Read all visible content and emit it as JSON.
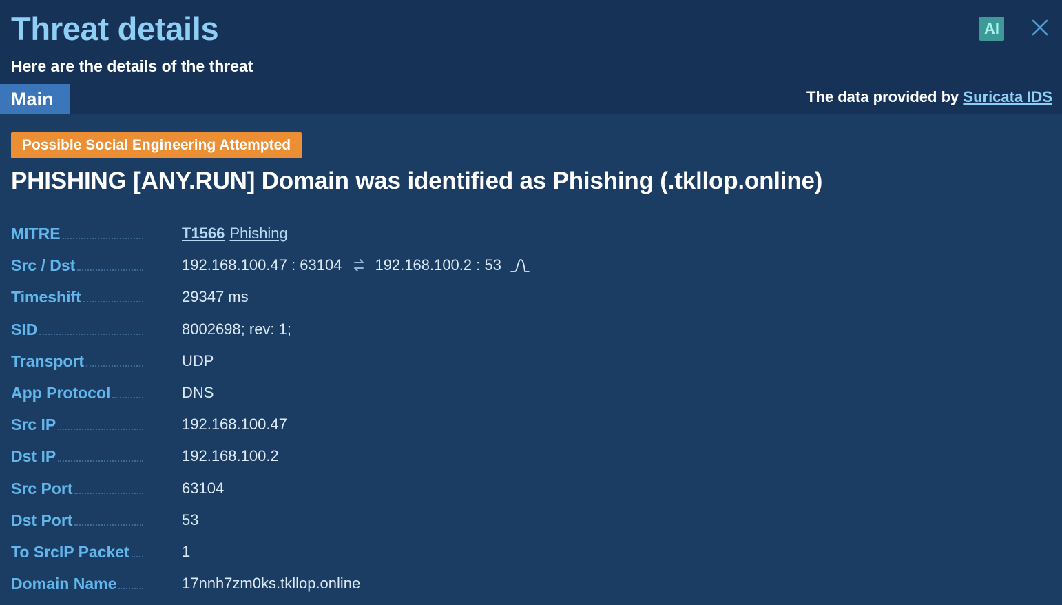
{
  "header": {
    "title": "Threat details",
    "subtitle": "Here are the details of the threat",
    "ai_label": "AI",
    "close_icon": "close-icon",
    "tabs": [
      {
        "label": "Main",
        "active": true
      }
    ],
    "provided_prefix": "The data provided by",
    "provided_link": "Suricata IDS"
  },
  "alert": {
    "category": "Possible Social Engineering Attempted",
    "category_color": "#ec8e34",
    "signature": "PHISHING [ANY.RUN] Domain was identified as Phishing (.tkllop.online)"
  },
  "details": {
    "mitre": {
      "label": "MITRE",
      "technique_id": "T1566",
      "technique_name": "Phishing"
    },
    "src_dst": {
      "label": "Src / Dst",
      "src": "192.168.100.47 : 63104",
      "dst": "192.168.100.2 : 53",
      "swap_icon": "swap-arrows-icon",
      "graph_icon": "signal-wave-icon"
    },
    "timeshift": {
      "label": "Timeshift",
      "value": "29347 ms"
    },
    "sid": {
      "label": "SID",
      "value": "8002698; rev: 1;"
    },
    "transport": {
      "label": "Transport",
      "value": "UDP"
    },
    "app_protocol": {
      "label": "App Protocol",
      "value": "DNS"
    },
    "src_ip": {
      "label": "Src IP",
      "value": "192.168.100.47"
    },
    "dst_ip": {
      "label": "Dst IP",
      "value": "192.168.100.2"
    },
    "src_port": {
      "label": "Src Port",
      "value": "63104"
    },
    "dst_port": {
      "label": "Dst Port",
      "value": "53"
    },
    "to_srcip_packet": {
      "label": "To SrcIP Packet",
      "value": "1"
    },
    "domain_name": {
      "label": "Domain Name",
      "value": "17nnh7zm0ks.tkllop.online"
    }
  }
}
